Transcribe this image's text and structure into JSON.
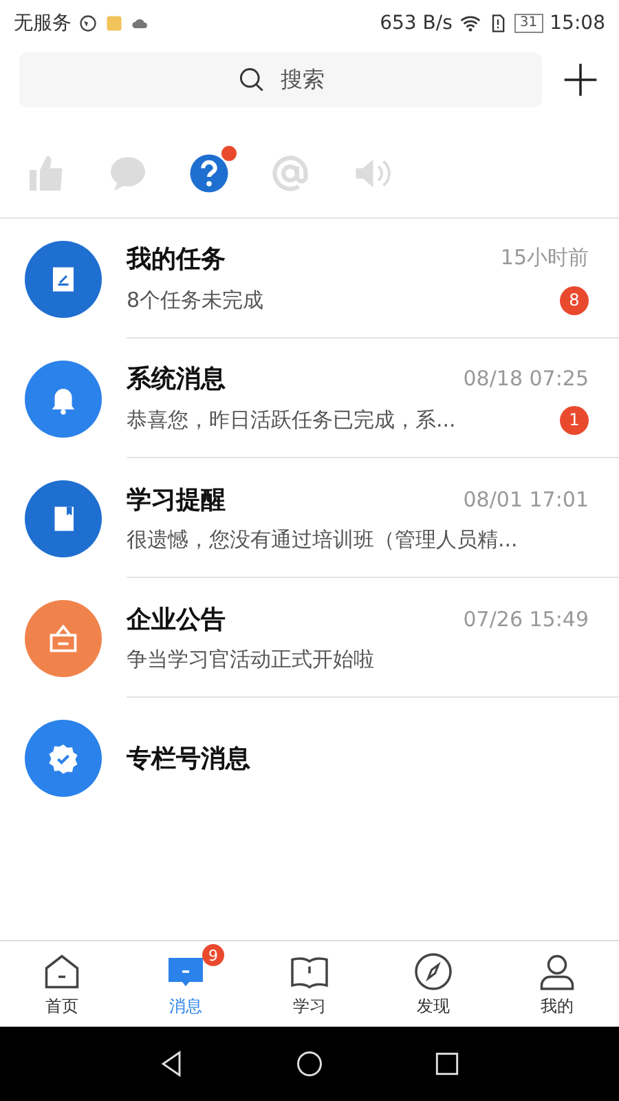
{
  "status_bar": {
    "carrier": "无服务",
    "speed": "653 B/s",
    "battery": "31",
    "time": "15:08"
  },
  "search": {
    "placeholder": "搜索"
  },
  "quick_tabs": [
    {
      "kind": "like",
      "selected": false,
      "dot": false
    },
    {
      "kind": "comment",
      "selected": false,
      "dot": false
    },
    {
      "kind": "question",
      "selected": true,
      "dot": true
    },
    {
      "kind": "at",
      "selected": false,
      "dot": false
    },
    {
      "kind": "speaker",
      "selected": false,
      "dot": false
    }
  ],
  "messages": [
    {
      "kind": "task",
      "color": "#1f6fd1",
      "title": "我的任务",
      "time": "15小时前",
      "preview": "8个任务未完成",
      "badge": "8"
    },
    {
      "kind": "bell",
      "color": "#2b82ea",
      "title": "系统消息",
      "time": "08/18 07:25",
      "preview": "恭喜您，昨日活跃任务已完成，系...",
      "badge": "1"
    },
    {
      "kind": "book",
      "color": "#1f6fd1",
      "title": "学习提醒",
      "time": "08/01 17:01",
      "preview": "很遗憾，您没有通过培训班（管理人员精..."
    },
    {
      "kind": "notice",
      "color": "#f0834c",
      "title": "企业公告",
      "time": "07/26 15:49",
      "preview": "争当学习官活动正式开始啦"
    },
    {
      "kind": "badge",
      "color": "#2b82ea",
      "title": "专栏号消息"
    }
  ],
  "bottom_nav": [
    {
      "kind": "home",
      "label": "首页",
      "selected": false
    },
    {
      "kind": "message",
      "label": "消息",
      "selected": true,
      "badge": "9"
    },
    {
      "kind": "study",
      "label": "学习",
      "selected": false
    },
    {
      "kind": "discover",
      "label": "发现",
      "selected": false
    },
    {
      "kind": "profile",
      "label": "我的",
      "selected": false
    }
  ]
}
